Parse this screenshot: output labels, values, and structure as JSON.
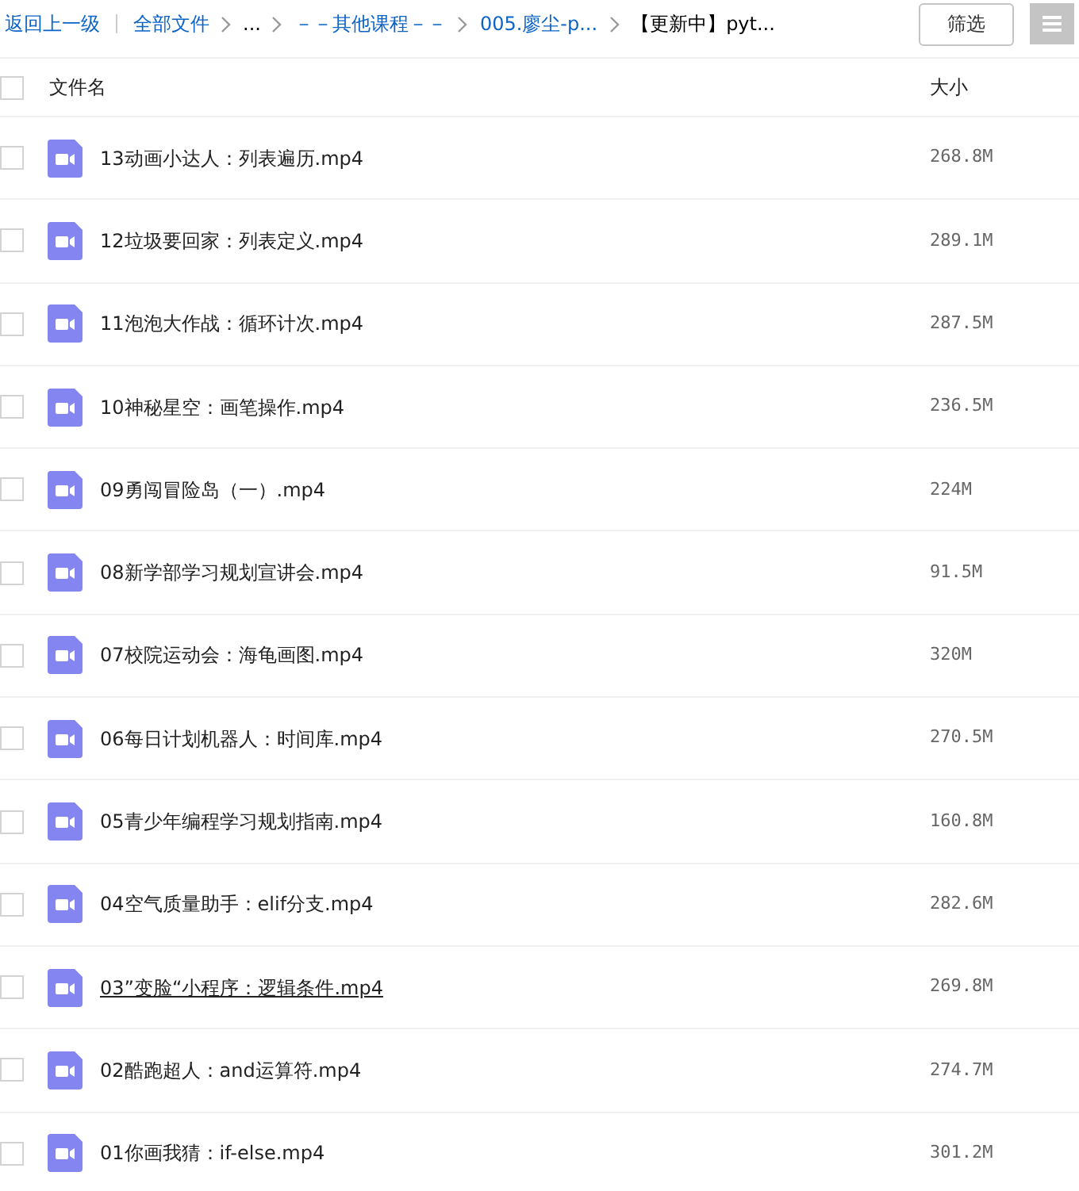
{
  "breadcrumb": {
    "back": "返回上一级",
    "items": [
      {
        "kind": "link",
        "label": "全部文件"
      },
      {
        "kind": "current",
        "label": "..."
      },
      {
        "kind": "link",
        "label": "－－其他课程－－"
      },
      {
        "kind": "link",
        "label": "005.廖尘-p..."
      },
      {
        "kind": "current",
        "label": "【更新中】pyt..."
      }
    ]
  },
  "filter_button": "筛选",
  "header": {
    "checked": false,
    "name": "文件名",
    "size": "大小"
  },
  "files": [
    {
      "name": "13动画小达人：列表遍历.mp4",
      "size": "268.8M",
      "checked": false,
      "hovered": false
    },
    {
      "name": "12垃圾要回家：列表定义.mp4",
      "size": "289.1M",
      "checked": false,
      "hovered": false
    },
    {
      "name": "11泡泡大作战：循环计次.mp4",
      "size": "287.5M",
      "checked": false,
      "hovered": false
    },
    {
      "name": "10神秘星空：画笔操作.mp4",
      "size": "236.5M",
      "checked": false,
      "hovered": false
    },
    {
      "name": "09勇闯冒险岛（一）.mp4",
      "size": "224M",
      "checked": false,
      "hovered": false
    },
    {
      "name": "08新学部学习规划宣讲会.mp4",
      "size": "91.5M",
      "checked": false,
      "hovered": false
    },
    {
      "name": "07校院运动会：海龟画图.mp4",
      "size": "320M",
      "checked": false,
      "hovered": false
    },
    {
      "name": "06每日计划机器人：时间库.mp4",
      "size": "270.5M",
      "checked": false,
      "hovered": false
    },
    {
      "name": "05青少年编程学习规划指南.mp4",
      "size": "160.8M",
      "checked": false,
      "hovered": false
    },
    {
      "name": "04空气质量助手：elif分支.mp4",
      "size": "282.6M",
      "checked": false,
      "hovered": false
    },
    {
      "name": "03”变脸“小程序：逻辑条件.mp4",
      "size": "269.8M",
      "checked": false,
      "hovered": true
    },
    {
      "name": "02酷跑超人：and运算符.mp4",
      "size": "274.7M",
      "checked": false,
      "hovered": false
    },
    {
      "name": "01你画我猜：if-else.mp4",
      "size": "301.2M",
      "checked": false,
      "hovered": false
    }
  ]
}
